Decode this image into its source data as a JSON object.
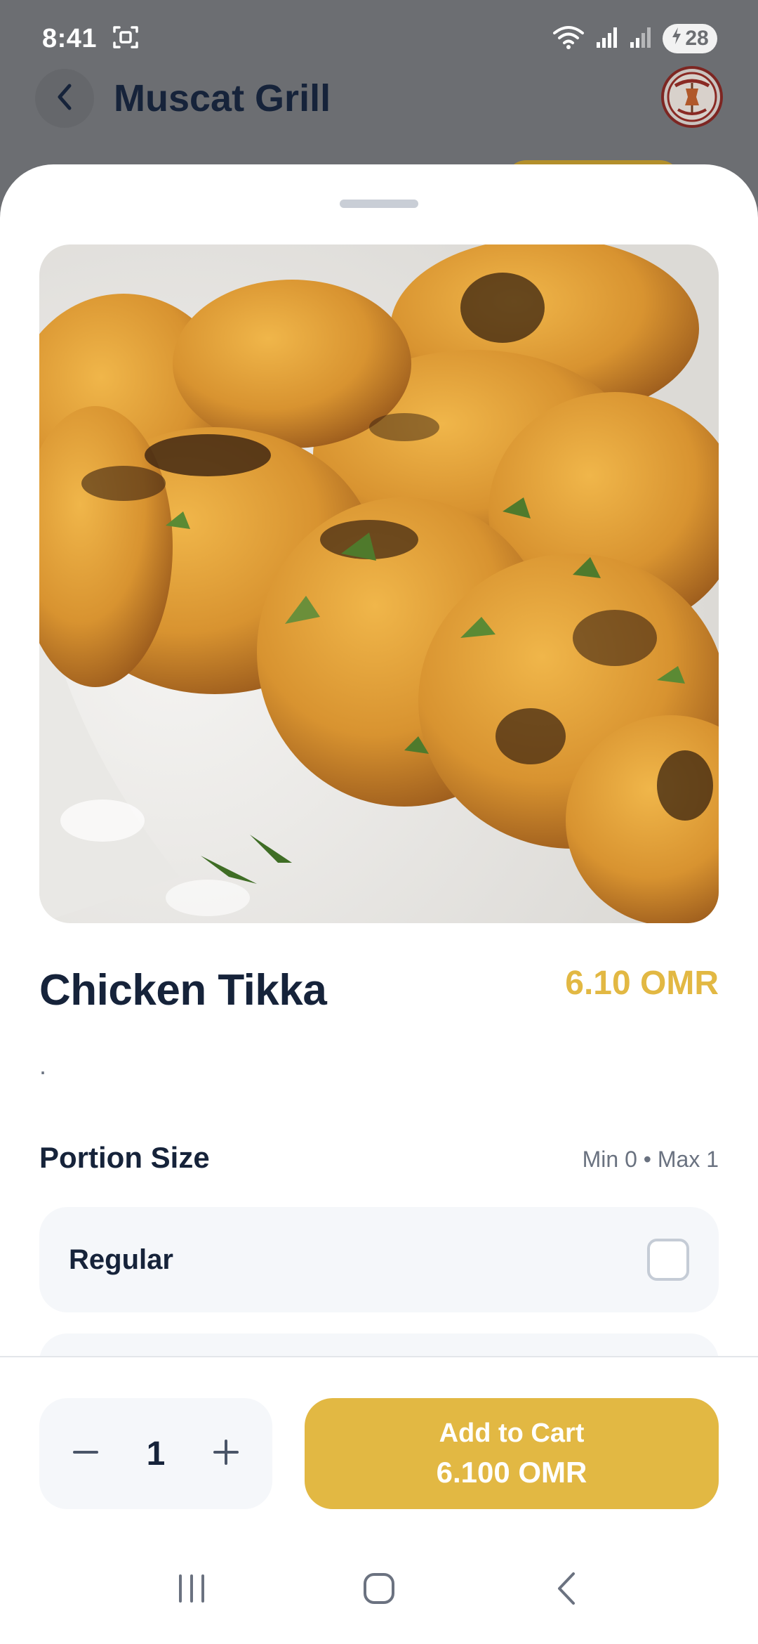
{
  "status_bar": {
    "time": "8:41",
    "battery": "28"
  },
  "header": {
    "title": "Muscat Grill"
  },
  "item": {
    "name": "Chicken Tikka",
    "price": "6.10 OMR",
    "description": "."
  },
  "portion": {
    "title": "Portion Size",
    "meta": "Min 0 • Max 1",
    "options": [
      {
        "label": "Regular",
        "checked": false
      }
    ]
  },
  "footer": {
    "quantity": "1",
    "add_label": "Add to Cart",
    "add_price": "6.100 OMR"
  },
  "colors": {
    "accent": "#e2b843",
    "title": "#16233a",
    "muted": "#6a7280",
    "card": "#f5f7fa"
  },
  "icons": {
    "back": "chevron-left-icon",
    "screenshot": "scan-frame-icon",
    "wifi": "wifi-icon",
    "signal": "signal-bars-icon",
    "battery": "battery-charging-icon",
    "minus": "minus-icon",
    "plus": "plus-icon",
    "nav_recents": "recents-icon",
    "nav_home": "home-icon",
    "nav_back": "back-icon"
  }
}
